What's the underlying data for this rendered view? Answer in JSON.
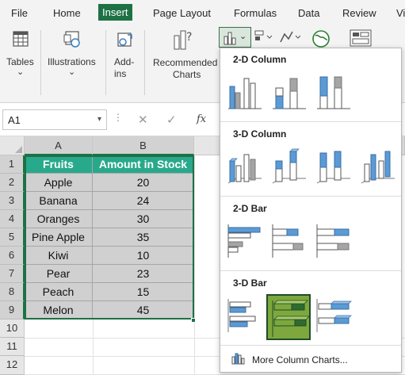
{
  "menubar": {
    "file": "File",
    "home": "Home",
    "insert": "Insert",
    "page_layout": "Page Layout",
    "formulas": "Formulas",
    "data": "Data",
    "review": "Review",
    "view_partial": "Vi"
  },
  "ribbon": {
    "tables": "Tables",
    "illustrations": "Illustrations",
    "addins_1": "Add-",
    "addins_2": "ins",
    "recommended_1": "Recommended",
    "recommended_2": "Charts",
    "chevron": "⌄"
  },
  "formula_bar": {
    "name_box": "A1",
    "name_box_caret": "▾",
    "dots": "⋮",
    "cancel": "✕",
    "enter": "✓",
    "fx": "fx"
  },
  "sheet": {
    "columns": [
      "A",
      "B"
    ],
    "rows": [
      "1",
      "2",
      "3",
      "4",
      "5",
      "6",
      "7",
      "8",
      "9",
      "10",
      "11",
      "12"
    ],
    "header": {
      "fruits": "Fruits",
      "amount": "Amount in Stock"
    },
    "data": [
      {
        "fruit": "Apple",
        "amount": "20"
      },
      {
        "fruit": "Banana",
        "amount": "24"
      },
      {
        "fruit": "Oranges",
        "amount": "30"
      },
      {
        "fruit": "Pine Apple",
        "amount": "35"
      },
      {
        "fruit": "Kiwi",
        "amount": "10"
      },
      {
        "fruit": "Pear",
        "amount": "23"
      },
      {
        "fruit": "Peach",
        "amount": "15"
      },
      {
        "fruit": "Melon",
        "amount": "45"
      }
    ]
  },
  "gallery": {
    "col2d": "2-D Column",
    "col3d": "3-D Column",
    "bar2d": "2-D Bar",
    "bar3d": "3-D Bar",
    "more": "More Column Charts...",
    "selected": "3-D Stacked Bar"
  },
  "colors": {
    "excel_green": "#1e7145",
    "header_teal": "#28a98c",
    "chart_blue": "#5b9bd5",
    "chart_gray": "#a5a5a5",
    "selected_green": "#7ea83d"
  }
}
